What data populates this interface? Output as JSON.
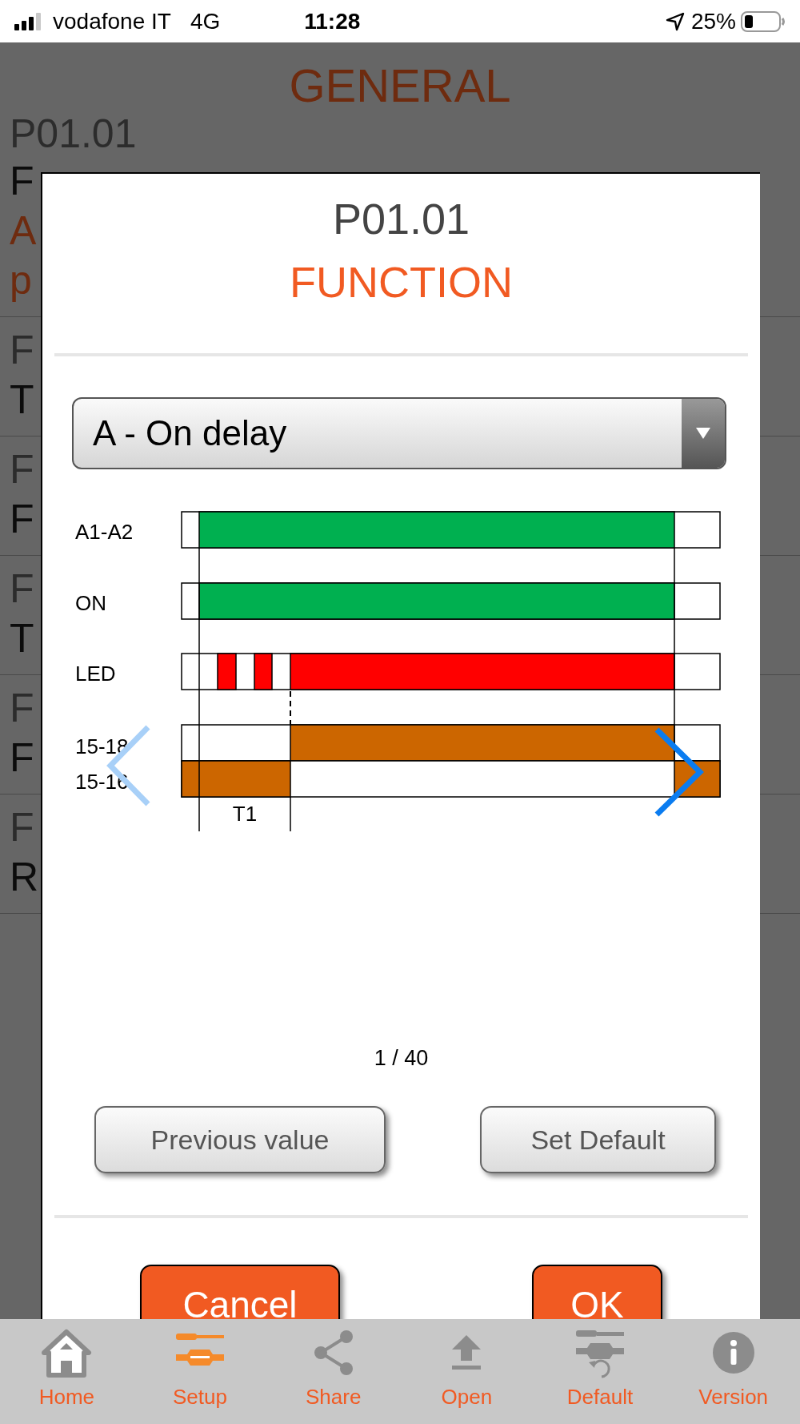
{
  "status_bar": {
    "carrier": "vodafone IT",
    "network": "4G",
    "time": "11:28",
    "battery": "25%"
  },
  "background": {
    "title": "GENERAL",
    "rows": [
      {
        "lines": [
          {
            "text": "P01.01",
            "color": "#2c2c2c"
          },
          {
            "text": "F",
            "color": "#0c0c0c"
          },
          {
            "text": "A",
            "color": "#6e2b0f"
          },
          {
            "text": "p",
            "color": "#6e2b0f"
          }
        ]
      },
      {
        "lines": [
          {
            "text": "F",
            "color": "#2c2c2c"
          },
          {
            "text": "T",
            "color": "#0c0c0c"
          }
        ]
      },
      {
        "lines": [
          {
            "text": "F",
            "color": "#2c2c2c"
          },
          {
            "text": "F",
            "color": "#0c0c0c"
          }
        ]
      },
      {
        "lines": [
          {
            "text": "F",
            "color": "#2c2c2c"
          },
          {
            "text": "T",
            "color": "#0c0c0c"
          }
        ]
      },
      {
        "lines": [
          {
            "text": "F",
            "color": "#2c2c2c"
          },
          {
            "text": "F",
            "color": "#0c0c0c"
          }
        ]
      },
      {
        "lines": [
          {
            "text": "F",
            "color": "#2c2c2c"
          },
          {
            "text": "R",
            "color": "#0c0c0c"
          }
        ]
      }
    ]
  },
  "dialog": {
    "code": "P01.01",
    "title": "FUNCTION",
    "select": {
      "value": "A - On delay"
    },
    "diagram": {
      "signals": [
        {
          "label": "A1-A2",
          "color": "#00b050"
        },
        {
          "label": "ON",
          "color": "#00b050"
        },
        {
          "label": "LED",
          "color": "#ff0000"
        },
        {
          "label": "15-18",
          "color": "#cc6600"
        },
        {
          "label": "15-16",
          "color": "#cc6600"
        }
      ],
      "interval": "T1"
    },
    "pager": "1 / 40",
    "buttons": [
      "Previous value",
      "Set Default"
    ],
    "actions": [
      "Cancel",
      "OK"
    ]
  },
  "tabs": [
    {
      "label": "Home",
      "selected": false
    },
    {
      "label": "Setup",
      "selected": true
    },
    {
      "label": "Share",
      "selected": false
    },
    {
      "label": "Open",
      "selected": false
    },
    {
      "label": "Default",
      "selected": false
    },
    {
      "label": "Version",
      "selected": false
    }
  ]
}
